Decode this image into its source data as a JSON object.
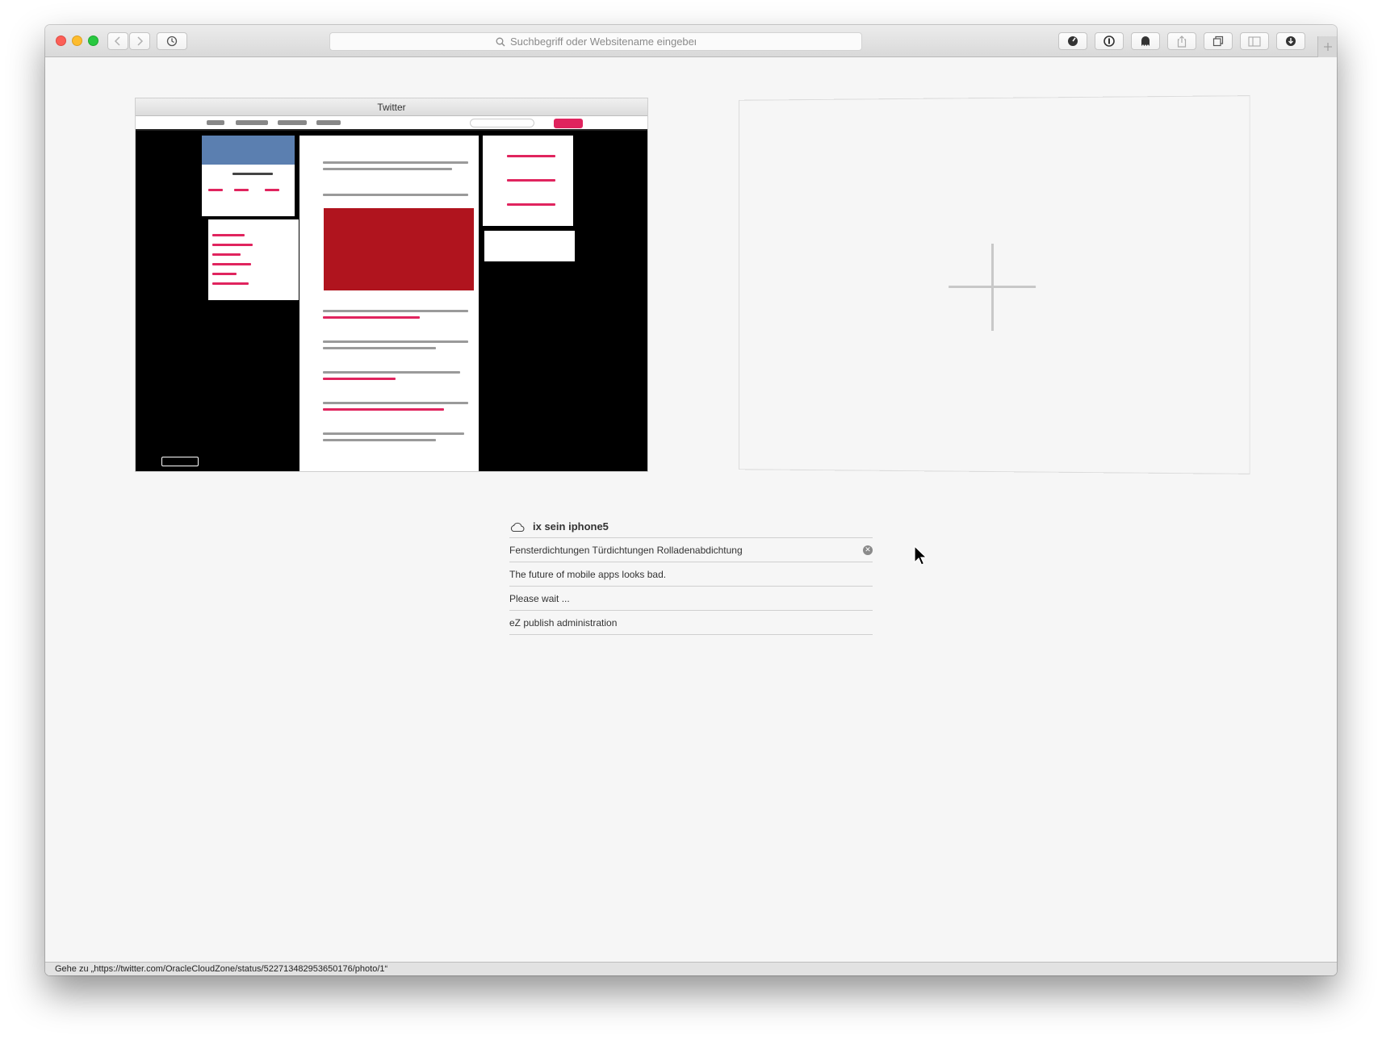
{
  "toolbar": {
    "url_placeholder": "Suchbegriff oder Websitename eingeben"
  },
  "top_sites": [
    {
      "title": "Twitter"
    }
  ],
  "icloud_tabs": {
    "device": "ix sein iphone5",
    "items": [
      {
        "title": "Fensterdichtungen Türdichtungen Rolladenabdichtung"
      },
      {
        "title": "The future of mobile apps looks bad."
      },
      {
        "title": "Please wait ..."
      },
      {
        "title": "eZ publish administration"
      }
    ]
  },
  "status_bar": "Gehe zu „https://twitter.com/OracleCloudZone/status/522713482953650176/photo/1“",
  "colors": {
    "twitter_red": "#e0245e",
    "close_red": "#fc5f57",
    "minimize_yellow": "#fdbc2e",
    "zoom_green": "#28c840"
  }
}
